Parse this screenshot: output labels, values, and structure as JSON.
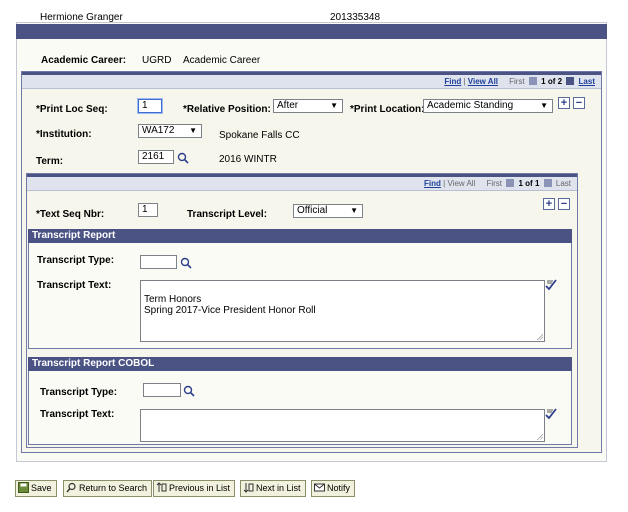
{
  "header": {
    "name": "Hermione Granger",
    "id": "201335348"
  },
  "career": {
    "label": "Academic Career:",
    "code": "UGRD",
    "description": "Academic Career"
  },
  "outer_nav": {
    "find": "Find",
    "view_all": "View All",
    "first": "First",
    "count": "1 of 2",
    "last": "Last"
  },
  "print_loc": {
    "seq_label": "*Print Loc Seq:",
    "seq_value": "1",
    "rel_label": "*Relative Position:",
    "rel_value": "After",
    "loc_label": "*Print Location:",
    "loc_value": "Academic Standing"
  },
  "institution": {
    "label": "*Institution:",
    "value": "WA172",
    "description": "Spokane Falls CC"
  },
  "term": {
    "label": "Term:",
    "value": "2161",
    "description": "2016 WINTR"
  },
  "inner_nav": {
    "find": "Find",
    "view_all": "View All",
    "first": "First",
    "count": "1 of 1",
    "last": "Last"
  },
  "text_seq": {
    "label": "*Text Seq Nbr:",
    "value": "1",
    "level_label": "Transcript Level:",
    "level_value": "Official"
  },
  "transcript_report": {
    "title": "Transcript Report",
    "type_label": "Transcript Type:",
    "type_value": "",
    "text_label": "Transcript Text:",
    "text_value": "Term Honors\nSpring 2017-Vice President Honor Roll"
  },
  "transcript_cobol": {
    "title": "Transcript Report COBOL",
    "type_label": "Transcript Type:",
    "type_value": "",
    "text_label": "Transcript Text:",
    "text_value": ""
  },
  "buttons": {
    "save": "Save",
    "return": "Return to Search",
    "previous": "Previous in List",
    "next": "Next in List",
    "notify": "Notify"
  },
  "colors": {
    "header_bar": "#4b5384",
    "link": "#1f3f9a",
    "button_bg": "#f1f1dd"
  }
}
